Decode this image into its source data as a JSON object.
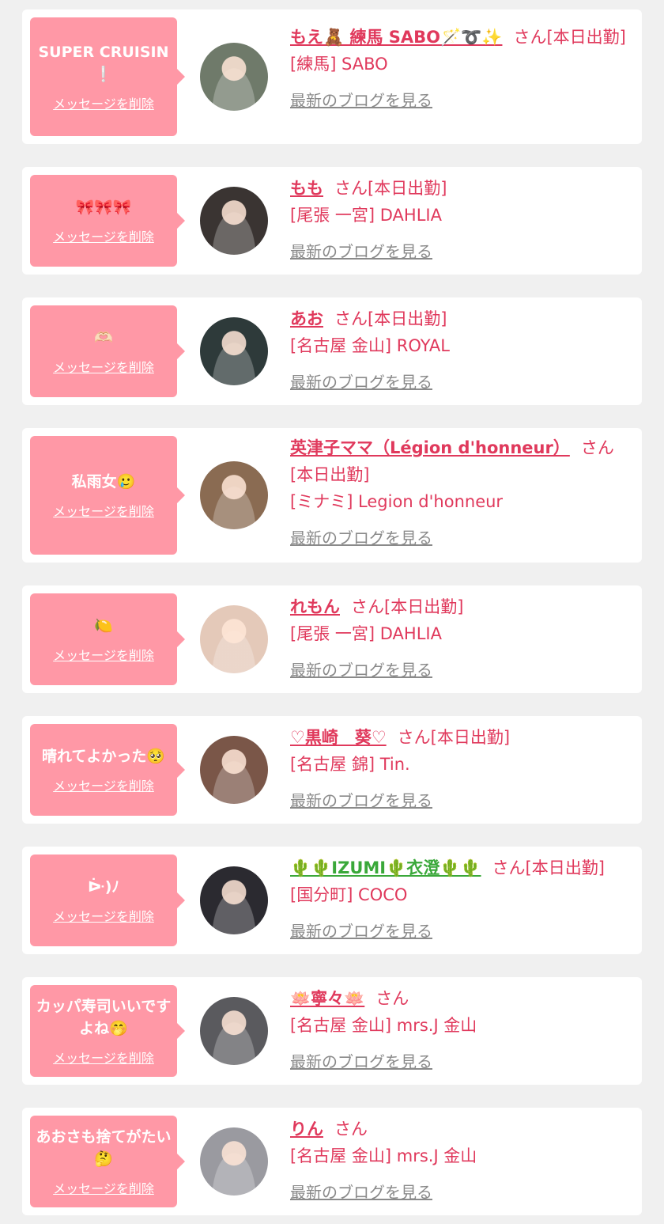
{
  "entries": [
    {
      "message": "SUPER CRUISIN❕",
      "delete_label": "メッセージを削除",
      "name": "もえ🧸 練馬 SABO🪄➰✨",
      "suffix": "さん[本日出勤]",
      "shop": "[練馬] SABO",
      "blog_label": "最新のブログを見る",
      "avatar_color": "#6f7a6a",
      "avatar_icon": "avatar-photo-icon"
    },
    {
      "message": "🎀🎀🎀",
      "delete_label": "メッセージを削除",
      "name": "もも",
      "suffix": "さん[本日出勤]",
      "shop": "[尾張 一宮] DAHLIA",
      "blog_label": "最新のブログを見る",
      "avatar_color": "#3a3432",
      "avatar_icon": "avatar-photo-icon"
    },
    {
      "message": "🫶🏻",
      "delete_label": "メッセージを削除",
      "name": "あお",
      "suffix": "さん[本日出勤]",
      "shop": "[名古屋 金山] ROYAL",
      "blog_label": "最新のブログを見る",
      "avatar_color": "#2e3a3a",
      "avatar_icon": "avatar-photo-icon"
    },
    {
      "message": "私雨女🥲",
      "delete_label": "メッセージを削除",
      "name": "英津子ママ（Légion d'honneur）",
      "suffix": "さん[本日出勤]",
      "shop": "[ミナミ] Legion d'honneur",
      "blog_label": "最新のブログを見る",
      "avatar_color": "#8a6b52",
      "avatar_icon": "avatar-photo-icon"
    },
    {
      "message": "🍋",
      "delete_label": "メッセージを削除",
      "name": "れもん",
      "suffix": "さん[本日出勤]",
      "shop": "[尾張 一宮] DAHLIA",
      "blog_label": "最新のブログを見る",
      "avatar_color": "#e4c9b9",
      "avatar_icon": "avatar-photo-icon"
    },
    {
      "message": "晴れてよかった🥺",
      "delete_label": "メッセージを削除",
      "name": "♡黒崎　葵♡",
      "suffix": "さん[本日出勤]",
      "shop": "[名古屋 錦] Tin.",
      "blog_label": "最新のブログを見る",
      "avatar_color": "#7a5648",
      "avatar_icon": "avatar-photo-icon"
    },
    {
      "message": "ᐕ)ﾉ",
      "delete_label": "メッセージを削除",
      "name": "🌵🌵IZUMI🌵衣澄🌵🌵",
      "suffix": "さん[本日出勤]",
      "shop": "[国分町] COCO",
      "blog_label": "最新のブログを見る",
      "avatar_color": "#2b2a30",
      "avatar_icon": "avatar-photo-icon"
    },
    {
      "message": "カッパ寿司いいですよね🤭",
      "delete_label": "メッセージを削除",
      "name": "🪷寧々🪷",
      "suffix": "さん",
      "shop": "[名古屋 金山] mrs.J 金山",
      "blog_label": "最新のブログを見る",
      "avatar_color": "#5a5a5e",
      "avatar_icon": "avatar-photo-icon"
    },
    {
      "message": "あおさも捨てがたい🤔",
      "delete_label": "メッセージを削除",
      "name": "りん",
      "suffix": "さん",
      "shop": "[名古屋 金山] mrs.J 金山",
      "blog_label": "最新のブログを見る",
      "avatar_color": "#9a9aa0",
      "avatar_icon": "avatar-photo-icon"
    }
  ],
  "colors": {
    "bubble": "#ff98a6",
    "name": "#e0395c",
    "link_gray": "#8a8a8a",
    "background": "#f0f0f0",
    "card": "#ffffff"
  }
}
